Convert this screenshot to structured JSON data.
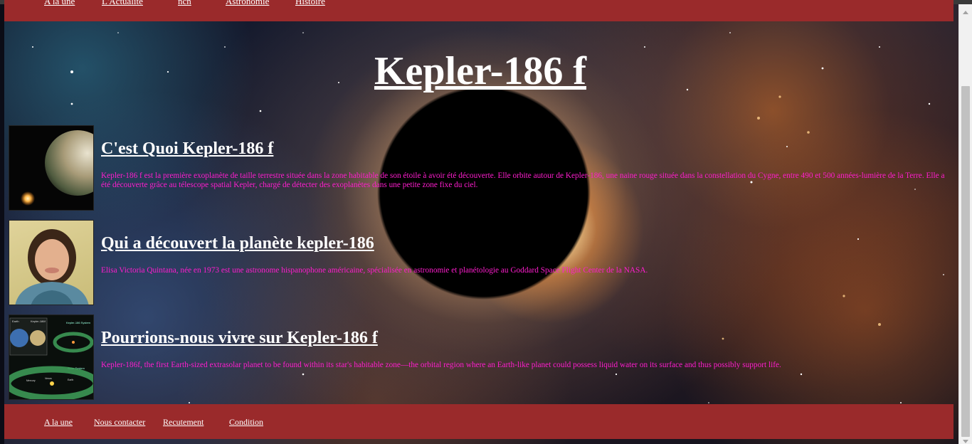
{
  "nav": {
    "items": [
      {
        "label": "A la une"
      },
      {
        "label": "L'Actualité"
      },
      {
        "label": "ncn"
      },
      {
        "label": "Astronomie"
      },
      {
        "label": "Histoire"
      }
    ]
  },
  "page": {
    "title": "Kepler-186 f"
  },
  "articles": [
    {
      "heading": "C'est Quoi Kepler-186 f",
      "text": "Kepler-186 f est la première exoplanète de taille terrestre située dans la zone habitable de son étoile à avoir été découverte. Elle orbite autour de Kepler-186, une naine rouge située dans la constellation du Cygne, entre 490 et 500 années-lumière de la Terre. Elle a été découverte grâce au télescope spatial Kepler, chargé de détecter des exoplanètes dans une petite zone fixe du ciel.",
      "thumb_icon": "planet-icon"
    },
    {
      "heading": "Qui a découvert la planète kepler-186",
      "text": "Elisa Victoria Quintana, née en 1973 est une astronome hispanophone américaine, spécialisée en astronomie et planétologie au Goddard Space Flight Center de la NASA.",
      "thumb_icon": "portrait-icon"
    },
    {
      "heading": "Pourrions-nous vivre sur Kepler-186 f",
      "text": "Kepler-186f, the first Earth-sized extrasolar planet to be found within its star's habitable zone—the orbital region where an Earth-like planet could possess liquid water on its surface and thus possibly support life.",
      "thumb_icon": "orbit-diagram-icon",
      "diagram_labels": {
        "earth": "Earth",
        "kepler": "Kepler-186f",
        "kepler_system": "Kepler-186 System",
        "solar_system": "Solar System",
        "earth_small": "Earth",
        "mercury": "Mercury",
        "venus": "Venus"
      }
    }
  ],
  "footer": {
    "links": [
      {
        "label": "A la une"
      },
      {
        "label": "Nous contacter"
      },
      {
        "label": "Recutement"
      },
      {
        "label": "Condition"
      }
    ]
  },
  "colors": {
    "bar": "#9a2a2b",
    "article_text": "#ff1dce",
    "heading": "#ffffff"
  }
}
